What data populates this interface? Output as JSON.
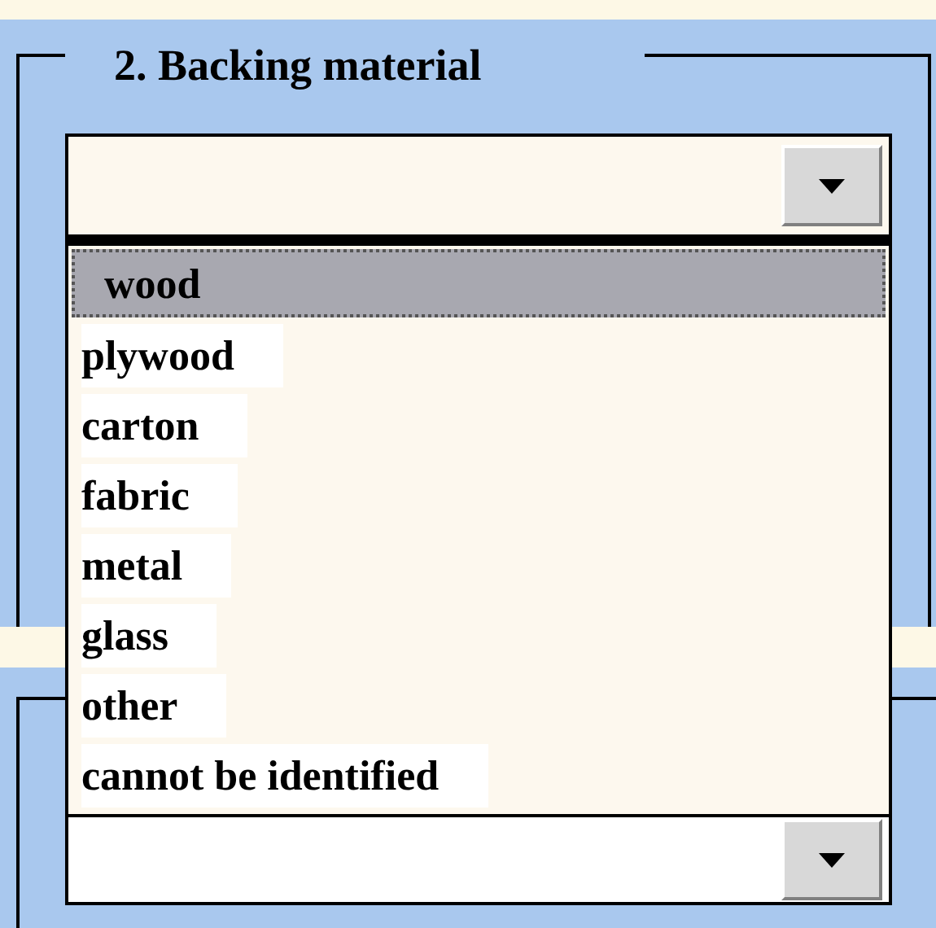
{
  "section": {
    "title": "2. Backing material"
  },
  "dropdown": {
    "expanded": true,
    "options": [
      {
        "label": "wood",
        "selected": true
      },
      {
        "label": "plywood",
        "selected": false
      },
      {
        "label": "carton",
        "selected": false
      },
      {
        "label": "fabric",
        "selected": false
      },
      {
        "label": "metal",
        "selected": false
      },
      {
        "label": "glass",
        "selected": false
      },
      {
        "label": "other",
        "selected": false
      },
      {
        "label": "cannot be identified",
        "selected": false
      }
    ]
  }
}
